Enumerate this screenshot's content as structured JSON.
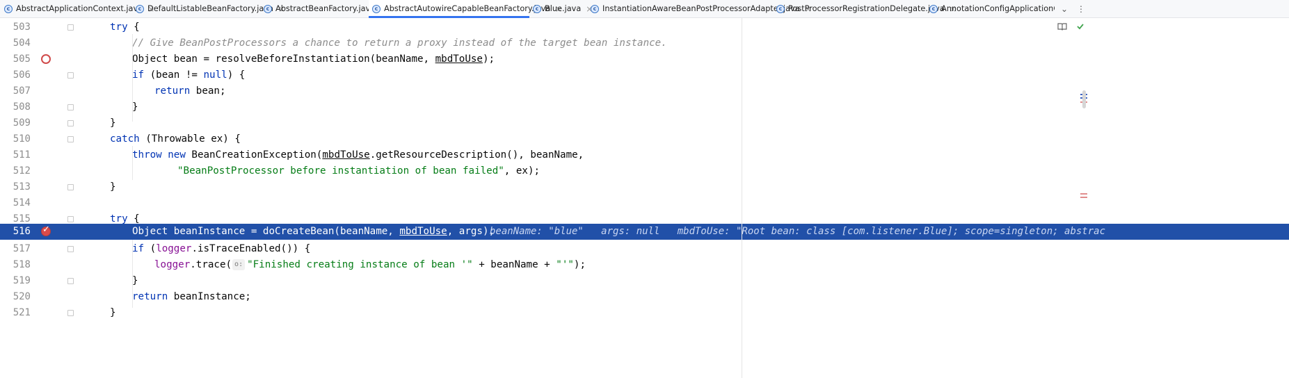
{
  "tabs": [
    {
      "label": "AbstractApplicationContext.java",
      "active": false
    },
    {
      "label": "DefaultListableBeanFactory.java",
      "active": false
    },
    {
      "label": "AbstractBeanFactory.java",
      "active": false
    },
    {
      "label": "AbstractAutowireCapableBeanFactory.java",
      "active": true
    },
    {
      "label": "Blue.java",
      "active": false
    },
    {
      "label": "InstantiationAwareBeanPostProcessorAdapter.java",
      "active": false
    },
    {
      "label": "PostProcessorRegistrationDelegate.java",
      "active": false
    },
    {
      "label": "AnnotationConfigApplicationContext.",
      "active": false
    }
  ],
  "tab_controls": {
    "overflow": "⌄",
    "menu": "⋮"
  },
  "editor": {
    "lines": [
      {
        "num": "503"
      },
      {
        "num": "504"
      },
      {
        "num": "505"
      },
      {
        "num": "506"
      },
      {
        "num": "507"
      },
      {
        "num": "508"
      },
      {
        "num": "509"
      },
      {
        "num": "510"
      },
      {
        "num": "511"
      },
      {
        "num": "512"
      },
      {
        "num": "513"
      },
      {
        "num": "514"
      },
      {
        "num": "515"
      },
      {
        "num": "516"
      },
      {
        "num": "517"
      },
      {
        "num": "518"
      },
      {
        "num": "519"
      },
      {
        "num": "520"
      },
      {
        "num": "521"
      }
    ],
    "tokens": {
      "try": "try",
      "brace_open": " {",
      "brace_close": "}",
      "comment_504": "// Give BeanPostProcessors a chance to return a proxy instead of the target bean instance.",
      "l505_a": "Object bean = resolveBeforeInstantiation(beanName, ",
      "mbdToUse": "mbdToUse",
      "l505_b": ");",
      "if": "if",
      "l506_a": " (bean != ",
      "null": "null",
      "l506_b": ") {",
      "return": "return",
      "l507_b": " bean;",
      "catch": "catch",
      "l510_b": " (Throwable ex) {",
      "throw": "throw",
      "new": "new",
      "l511_a": " BeanCreationException(",
      "l511_b": ".getResourceDescription(), beanName,",
      "l512_str": "\"BeanPostProcessor before instantiation of bean failed\"",
      "l512_b": ", ex);",
      "l516_a": "Object beanInstance = doCreateBean(beanName, ",
      "l516_b": ", args);",
      "l517_a": " (",
      "logger": "logger",
      "l517_b": ".isTraceEnabled()) {",
      "l518_b": ".trace(",
      "hint_o": "o:",
      "l518_str": "\"Finished creating instance of bean '\"",
      "l518_c": " + beanName + ",
      "l518_str2": "\"'\"",
      "l518_d": ");",
      "l520_b": " beanInstance;"
    },
    "inline_debug": "beanName: \"blue\"   args: null   mbdToUse: \"Root bean: class [com.listener.Blue]; scope=singleton; abstrac"
  },
  "right_toolbar": {
    "reader_mode_icon": "book-icon",
    "status_icon": "check-icon"
  },
  "colors": {
    "keyword": "#0033b3",
    "comment": "#8c8c8c",
    "string": "#067d17",
    "field": "#871094",
    "execution_line": "#2150a8",
    "breakpoint": "#d94b4b",
    "active_tab_underline": "#3574f0"
  }
}
